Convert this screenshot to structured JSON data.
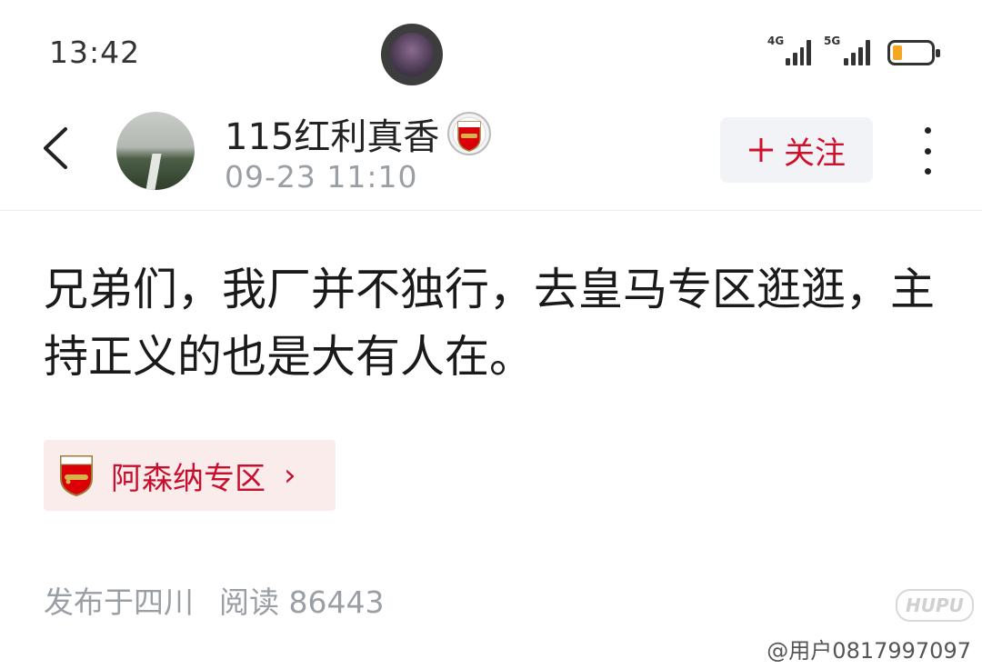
{
  "status_bar": {
    "time": "13:42",
    "network1": "4G",
    "network2": "5G",
    "battery_level": 0.2,
    "battery_color": "#f5a623"
  },
  "header": {
    "back_icon": "chevron-left-icon",
    "username": "115红利真香",
    "badge_icon": "arsenal-crest-icon",
    "post_time": "09-23 11:10",
    "follow_label": "关注",
    "follow_icon": "plus-icon",
    "more_icon": "more-vertical-icon"
  },
  "post": {
    "text": "兄弟们，我厂并不独行，去皇马专区逛逛，主持正义的也是大有人在。"
  },
  "zone_tag": {
    "label": "阿森纳专区",
    "icon": "arsenal-crest-icon",
    "chevron": "›"
  },
  "meta": {
    "location": "发布于四川",
    "reads": "阅读 86443"
  },
  "watermark": {
    "brand": "HUPU",
    "user": "@用户0817997097"
  },
  "colors": {
    "accent": "#d0102a",
    "tag_bg": "#fbecec",
    "muted": "#9a9ea5"
  }
}
